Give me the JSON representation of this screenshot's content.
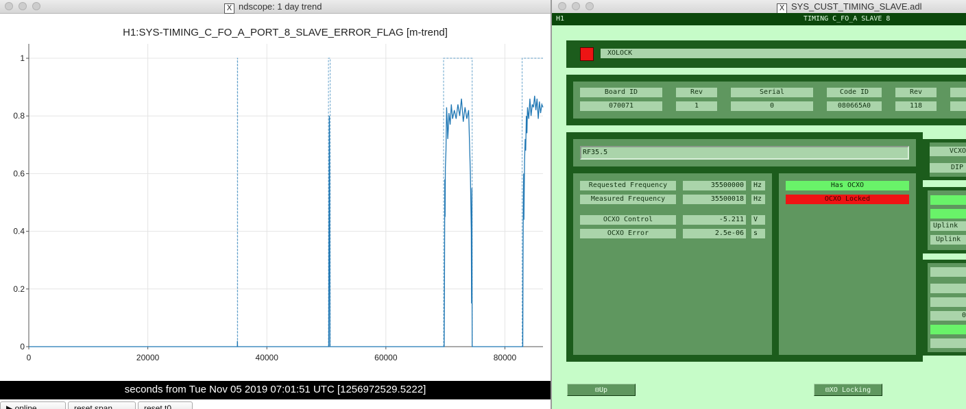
{
  "ndscope": {
    "window_title": "ndscope: 1 day trend",
    "xaxis_label": "seconds from Tue Nov 05 2019 07:01:51 UTC [1256972529.5222]",
    "buttons": [
      "▶ online",
      "reset span",
      "reset t0"
    ],
    "line_color": "#1f77b4"
  },
  "chart_data": {
    "type": "line",
    "title": "H1:SYS-TIMING_C_FO_A_PORT_8_SLAVE_ERROR_FLAG [m-trend]",
    "xlabel": "seconds from Tue Nov 05 2019 07:01:51 UTC [1256972529.5222]",
    "ylabel": "",
    "xlim": [
      0,
      86400
    ],
    "ylim": [
      0,
      1.05
    ],
    "xticks": [
      0,
      20000,
      40000,
      60000,
      80000
    ],
    "xtick_labels": [
      "0",
      "20000",
      "40000",
      "60000",
      "80000"
    ],
    "yticks": [
      0,
      0.2,
      0.4,
      0.6,
      0.8,
      1
    ],
    "ytick_labels": [
      "0",
      "0.2",
      "0.4",
      "0.6",
      "0.8",
      "1"
    ],
    "grid": true,
    "series": [
      {
        "style": "solid",
        "x": [
          0,
          35040,
          35060,
          35080,
          35100,
          50400,
          50450,
          50500,
          50550,
          50600,
          50700,
          69800,
          69850,
          69900,
          69950,
          70000,
          70100,
          70200,
          70300,
          70400,
          70500,
          70600,
          70800,
          71000,
          71200,
          71500,
          71800,
          72100,
          72400,
          72700,
          73000,
          73300,
          73600,
          73900,
          74200,
          74350,
          74400,
          74450,
          74500,
          74600,
          83000,
          83050,
          83100,
          83150,
          83200,
          83300,
          83400,
          83500,
          83600,
          83700,
          83800,
          84000,
          84200,
          84400,
          84600,
          84800,
          85000,
          85200,
          85400,
          85600,
          85800,
          86000,
          86200,
          86400
        ],
        "y": [
          0,
          0,
          0.02,
          0.0,
          0,
          0,
          0.4,
          0.8,
          0.6,
          0.0,
          0,
          0,
          0.2,
          0.58,
          0.45,
          0.62,
          0.68,
          0.83,
          0.79,
          0.72,
          0.76,
          0.81,
          0.77,
          0.84,
          0.79,
          0.82,
          0.79,
          0.84,
          0.8,
          0.86,
          0.78,
          0.83,
          0.79,
          0.82,
          0.6,
          0.4,
          0.15,
          0.55,
          0.0,
          0,
          0,
          0.3,
          0.52,
          0.6,
          0.44,
          0.64,
          0.72,
          0.68,
          0.8,
          0.74,
          0.83,
          0.79,
          0.86,
          0.8,
          0.84,
          0.83,
          0.87,
          0.82,
          0.86,
          0.79,
          0.85,
          0.81,
          0.84,
          0.83
        ]
      },
      {
        "style": "dotted",
        "x": [
          35050,
          35050,
          35090,
          35090,
          50350,
          50350,
          50650,
          50650,
          69700,
          69700,
          74500,
          74500,
          82900,
          82900,
          86400
        ],
        "y": [
          0,
          1,
          1,
          0,
          0,
          1,
          1,
          0,
          0,
          1,
          1,
          0,
          0,
          1,
          1
        ]
      }
    ]
  },
  "medm": {
    "window_title": "SYS_CUST_TIMING_SLAVE.adl",
    "bar_left": "H1",
    "bar_center": "TIMING C_FO_A SLAVE 8",
    "lock_label": "XOLOCK",
    "lock_indicator_color": "#ee1414",
    "board_headers": [
      "Board ID",
      "Rev",
      "Serial",
      "Code ID",
      "Rev"
    ],
    "board_values": [
      "070071",
      "1",
      "0",
      "080665A0",
      "118"
    ],
    "name_field": "RF35.5",
    "right_labels": [
      "VCXO",
      "DIP",
      "Uplink",
      "Uplink"
    ],
    "rows": [
      {
        "label": "Requested Frequency",
        "value": "35500000",
        "unit": "Hz"
      },
      {
        "label": "Measured Frequency",
        "value": "35500018",
        "unit": "Hz"
      },
      {
        "label": "OCXO Control",
        "value": "-5.211",
        "unit": "V"
      },
      {
        "label": "OCXO Error",
        "value": "2.5e-06",
        "unit": "s"
      }
    ],
    "has_ocxo": "Has OCXO",
    "ocxo_locked": "OCXO Locked",
    "partial_value": "0",
    "up_button": "⊟Up",
    "locking_button": "⊟XO Locking"
  }
}
